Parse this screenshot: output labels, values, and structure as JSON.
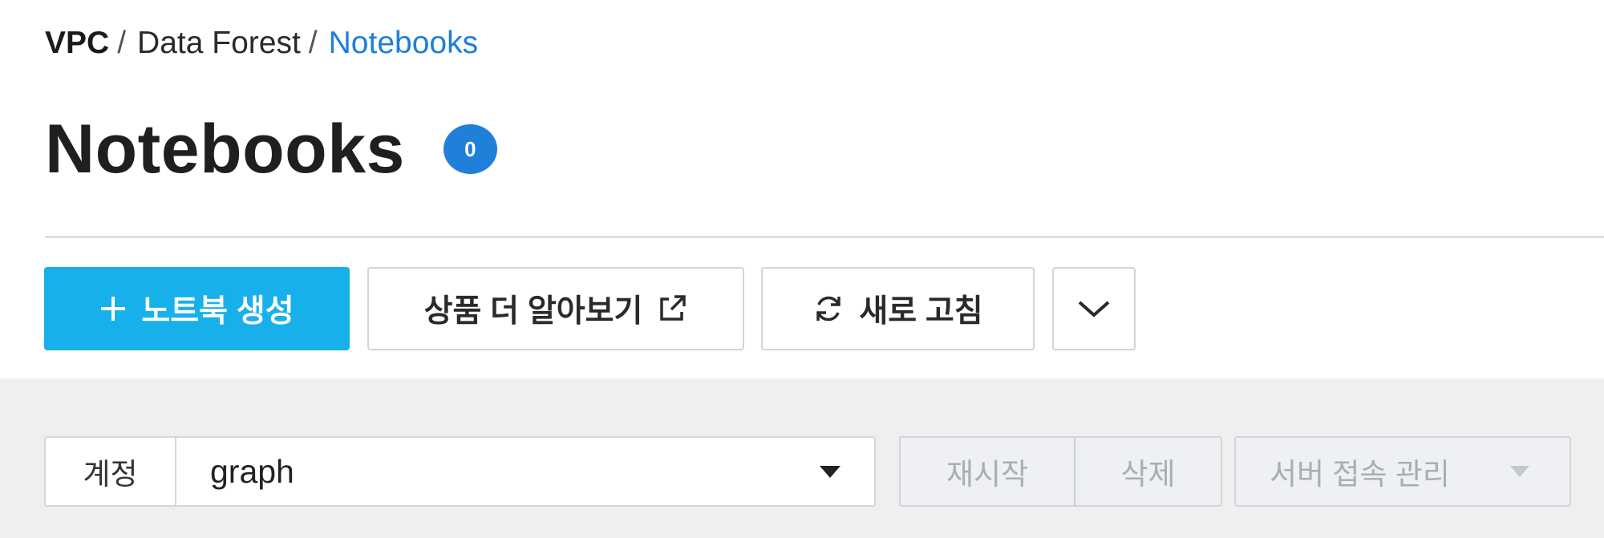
{
  "breadcrumb": {
    "root": "VPC",
    "sep1": "/",
    "middle": "Data Forest",
    "sep2": "/",
    "current": "Notebooks"
  },
  "header": {
    "title": "Notebooks",
    "count": "0"
  },
  "toolbar": {
    "create_label": "노트북 생성",
    "learn_more_label": "상품 더 알아보기",
    "refresh_label": "새로 고침"
  },
  "filter": {
    "account_label": "계정",
    "account_value": "graph"
  },
  "actions": {
    "restart_label": "재시작",
    "delete_label": "삭제",
    "server_access_label": "서버 접속 관리"
  },
  "icons": {
    "create": "plus-icon",
    "learn_more": "external-link-icon",
    "refresh": "refresh-icon",
    "more": "chevron-down-icon",
    "select": "caret-down-icon"
  },
  "colors": {
    "primary": "#18b0ea",
    "link": "#1e7fd8",
    "badge": "#1f7fd9",
    "disabled_text": "#a9adb4"
  }
}
